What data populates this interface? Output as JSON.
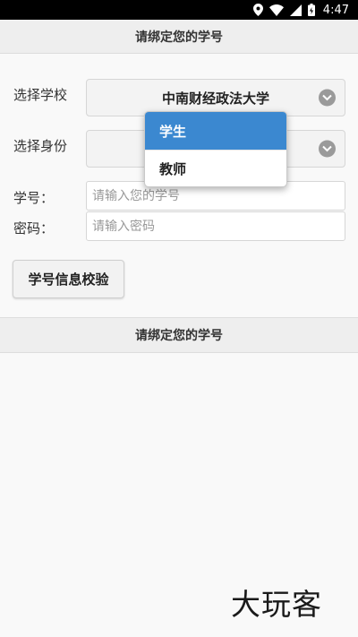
{
  "status_bar": {
    "time": "4:47"
  },
  "header": {
    "title": "请绑定您的学号"
  },
  "form": {
    "school_label": "选择学校",
    "school_value": "中南财经政法大学",
    "identity_label": "选择身份",
    "student_id_label": "学号：",
    "student_id_placeholder": "请输入您的学号",
    "password_label": "密码：",
    "password_placeholder": "请输入密码",
    "verify_button": "学号信息校验"
  },
  "identity_dropdown": {
    "options": [
      "学生",
      "教师"
    ],
    "selected": "学生"
  },
  "footer": {
    "title": "请绑定您的学号"
  },
  "watermark": {
    "text": "大玩客"
  },
  "colors": {
    "accent": "#3b88d0",
    "header_bg": "#eeeeee"
  }
}
